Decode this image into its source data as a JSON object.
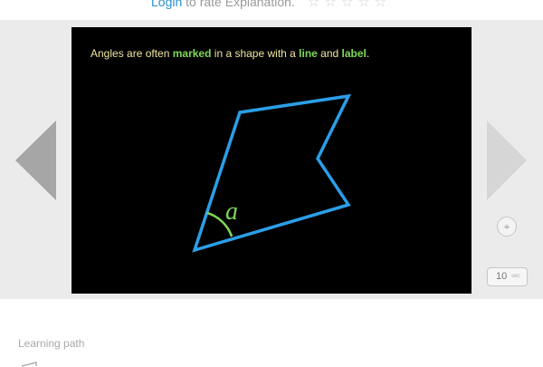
{
  "rating": {
    "login_link": "Login",
    "prompt": " to rate Explanation.",
    "stars": "☆☆☆☆☆"
  },
  "slide": {
    "caption_parts": [
      "Angles are often ",
      "marked",
      " in a shape with a ",
      "line",
      " and ",
      "label",
      "."
    ],
    "angle_label": "a",
    "shape_color": "#2b9fe8",
    "angle_arc_color": "#7ed957",
    "highlight_color": "#7ed957",
    "caption_color": "#f0e6a0"
  },
  "controls": {
    "prev_icon": "left-triangle-arrow",
    "next_icon": "right-triangle-arrow",
    "target_icon": "crosshair-icon",
    "target_glyph": "⌖",
    "speed_value": "10",
    "speed_unit": "sec"
  },
  "learning_path": {
    "label": "Learning path"
  }
}
